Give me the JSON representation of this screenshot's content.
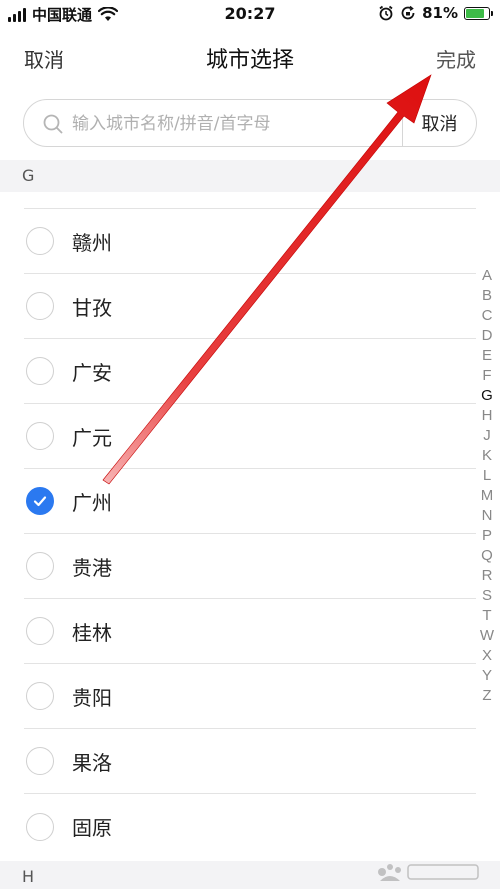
{
  "status_bar": {
    "carrier": "中国联通",
    "time": "20:27",
    "battery_percent": "81%",
    "battery_level": 0.81
  },
  "nav": {
    "cancel_label": "取消",
    "title": "城市选择",
    "done_label": "完成"
  },
  "search": {
    "placeholder": "输入城市名称/拼音/首字母",
    "value": "",
    "cancel_label": "取消"
  },
  "sections": [
    {
      "letter": "G",
      "cities": [
        {
          "name": "赣州",
          "selected": false
        },
        {
          "name": "甘孜",
          "selected": false
        },
        {
          "name": "广安",
          "selected": false
        },
        {
          "name": "广元",
          "selected": false
        },
        {
          "name": "广州",
          "selected": true
        },
        {
          "name": "贵港",
          "selected": false
        },
        {
          "name": "桂林",
          "selected": false
        },
        {
          "name": "贵阳",
          "selected": false
        },
        {
          "name": "果洛",
          "selected": false
        },
        {
          "name": "固原",
          "selected": false
        }
      ]
    },
    {
      "letter": "H",
      "cities": []
    }
  ],
  "index_letters": [
    "A",
    "B",
    "C",
    "D",
    "E",
    "F",
    "G",
    "H",
    "J",
    "K",
    "L",
    "M",
    "N",
    "P",
    "Q",
    "R",
    "S",
    "T",
    "W",
    "X",
    "Y",
    "Z"
  ],
  "active_index": "G",
  "colors": {
    "accent": "#2b79f0",
    "annotation_arrow": "#e01010"
  }
}
